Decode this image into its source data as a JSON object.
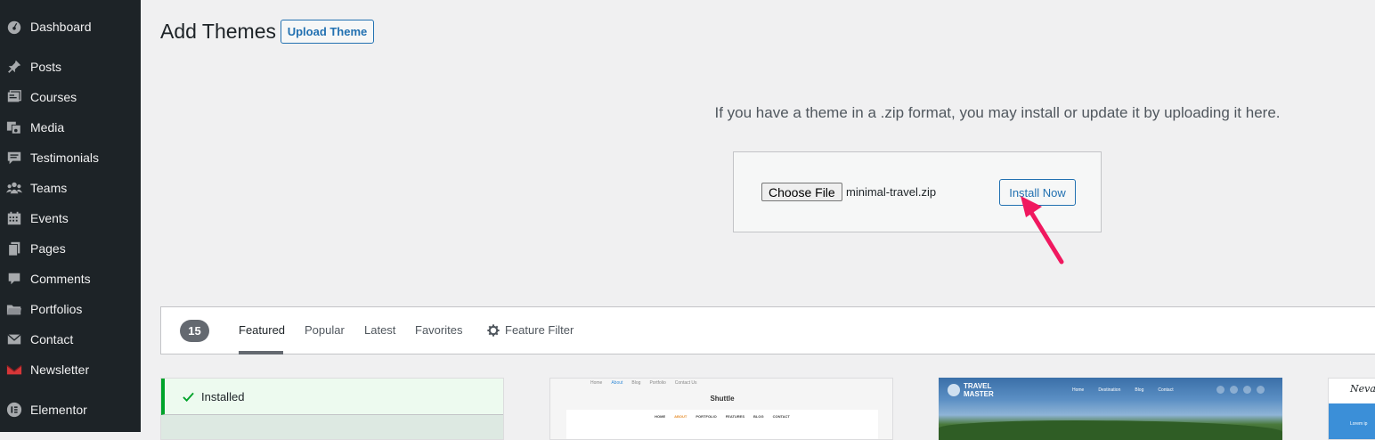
{
  "sidebar": {
    "items": [
      {
        "label": "Dashboard",
        "icon": "dashboard-icon"
      },
      {
        "label": "Posts",
        "icon": "pin-icon"
      },
      {
        "label": "Courses",
        "icon": "courses-icon"
      },
      {
        "label": "Media",
        "icon": "media-icon"
      },
      {
        "label": "Testimonials",
        "icon": "testimonial-icon"
      },
      {
        "label": "Teams",
        "icon": "teams-icon"
      },
      {
        "label": "Events",
        "icon": "calendar-icon"
      },
      {
        "label": "Pages",
        "icon": "pages-icon"
      },
      {
        "label": "Comments",
        "icon": "comment-icon"
      },
      {
        "label": "Portfolios",
        "icon": "folder-icon"
      },
      {
        "label": "Contact",
        "icon": "envelope-icon"
      },
      {
        "label": "Newsletter",
        "icon": "mail-icon"
      },
      {
        "label": "Elementor",
        "icon": "elementor-icon"
      }
    ]
  },
  "header": {
    "title": "Add Themes",
    "upload_button": "Upload Theme"
  },
  "upload": {
    "help_text": "If you have a theme in a .zip format, you may install or update it by uploading it here.",
    "choose_file_label": "Choose File",
    "file_name": "minimal-travel.zip",
    "install_button": "Install Now",
    "arrow_color": "#f0185f"
  },
  "filter_bar": {
    "count": "15",
    "tabs": [
      "Featured",
      "Popular",
      "Latest",
      "Favorites"
    ],
    "active_tab": "Featured",
    "feature_filter": "Feature Filter"
  },
  "themes": {
    "installed_label": "Installed",
    "card2": {
      "nav": [
        "Home",
        "About",
        "Blog",
        "Portfolio",
        "Contact Us"
      ],
      "title": "Shuttle",
      "menu": [
        "HOME",
        "ABOUT",
        "PORTFOLIO",
        "FEATURES",
        "BLOG",
        "CONTACT"
      ]
    },
    "card3": {
      "logo_line1": "TRAVEL",
      "logo_line2": "MASTER",
      "nav": [
        "Home",
        "Destination",
        "Blog",
        "Contact"
      ]
    },
    "card4": {
      "script_title": "Nevad",
      "text": "Lorem ip"
    }
  },
  "colors": {
    "sidebar_bg": "#1d2327",
    "accent": "#2271b1",
    "installed_green": "#00a32a"
  }
}
